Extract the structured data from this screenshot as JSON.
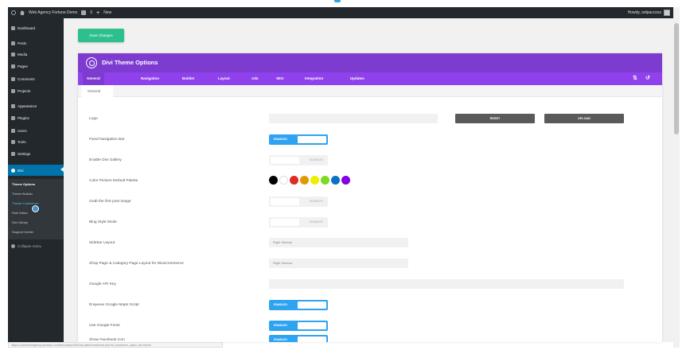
{
  "admin_bar": {
    "site_name": "Web Agency Fortune Demo",
    "comments_count": "0",
    "new_label": "New",
    "howdy": "Howdy, wdpaccess"
  },
  "sidebar": {
    "items": [
      {
        "label": "Dashboard",
        "icon": "dashboard-icon"
      },
      {
        "label": "Posts",
        "icon": "pin-icon"
      },
      {
        "label": "Media",
        "icon": "media-icon"
      },
      {
        "label": "Pages",
        "icon": "pages-icon"
      },
      {
        "label": "Comments",
        "icon": "comment-icon"
      },
      {
        "label": "Projects",
        "icon": "pin-icon"
      },
      {
        "label": "Appearance",
        "icon": "brush-icon"
      },
      {
        "label": "Plugins",
        "icon": "plug-icon"
      },
      {
        "label": "Users",
        "icon": "user-icon"
      },
      {
        "label": "Tools",
        "icon": "wrench-icon"
      },
      {
        "label": "Settings",
        "icon": "settings-icon"
      },
      {
        "label": "Divi",
        "icon": "divi-icon"
      }
    ],
    "submenu": [
      "Theme Options",
      "Theme Builder",
      "Theme Customizer",
      "Role Editor",
      "Divi Library",
      "Support Center"
    ],
    "collapse_label": "Collapse menu"
  },
  "save_button": "Save Changes",
  "panel": {
    "title": "Divi Theme Options",
    "tabs": [
      "General",
      "Navigation",
      "Builder",
      "Layout",
      "Ads",
      "SEO",
      "Integration",
      "Updates"
    ],
    "subtab": "General",
    "reset_label": "RESET",
    "upload_label": "UPLOAD",
    "enabled_label": "ENABLED",
    "disabled_label": "DISABLED",
    "rows": {
      "logo": "Logo",
      "fixed_nav": "Fixed Navigation Bar",
      "divi_gallery": "Enable Divi Gallery",
      "color_palette": "Color Pickers Default Palette",
      "grab_first_image": "Grab the first post image",
      "blog_style": "Blog Style Mode",
      "sidebar_layout": "Sidebar Layout",
      "shop_layout": "Shop Page & Category Page Layout for WooCommerce",
      "google_api": "Google API Key",
      "enqueue_maps": "Enqueue Google Maps Script",
      "google_fonts": "Use Google Fonts",
      "last_row": "Show Facebook Icon"
    },
    "sidebar_layout_value": "Right Sidebar",
    "shop_layout_value": "Right Sidebar",
    "palette_colors": [
      "#000000",
      "#ffffff",
      "#e02b20",
      "#e09900",
      "#edf000",
      "#7cda24",
      "#0c71c3",
      "#8300e9"
    ]
  },
  "status_url": "https://cudomeberagencyoperation.com/demo/wdpcf/001/wp-admin/customize.php?et_customizer_option_set=theme"
}
